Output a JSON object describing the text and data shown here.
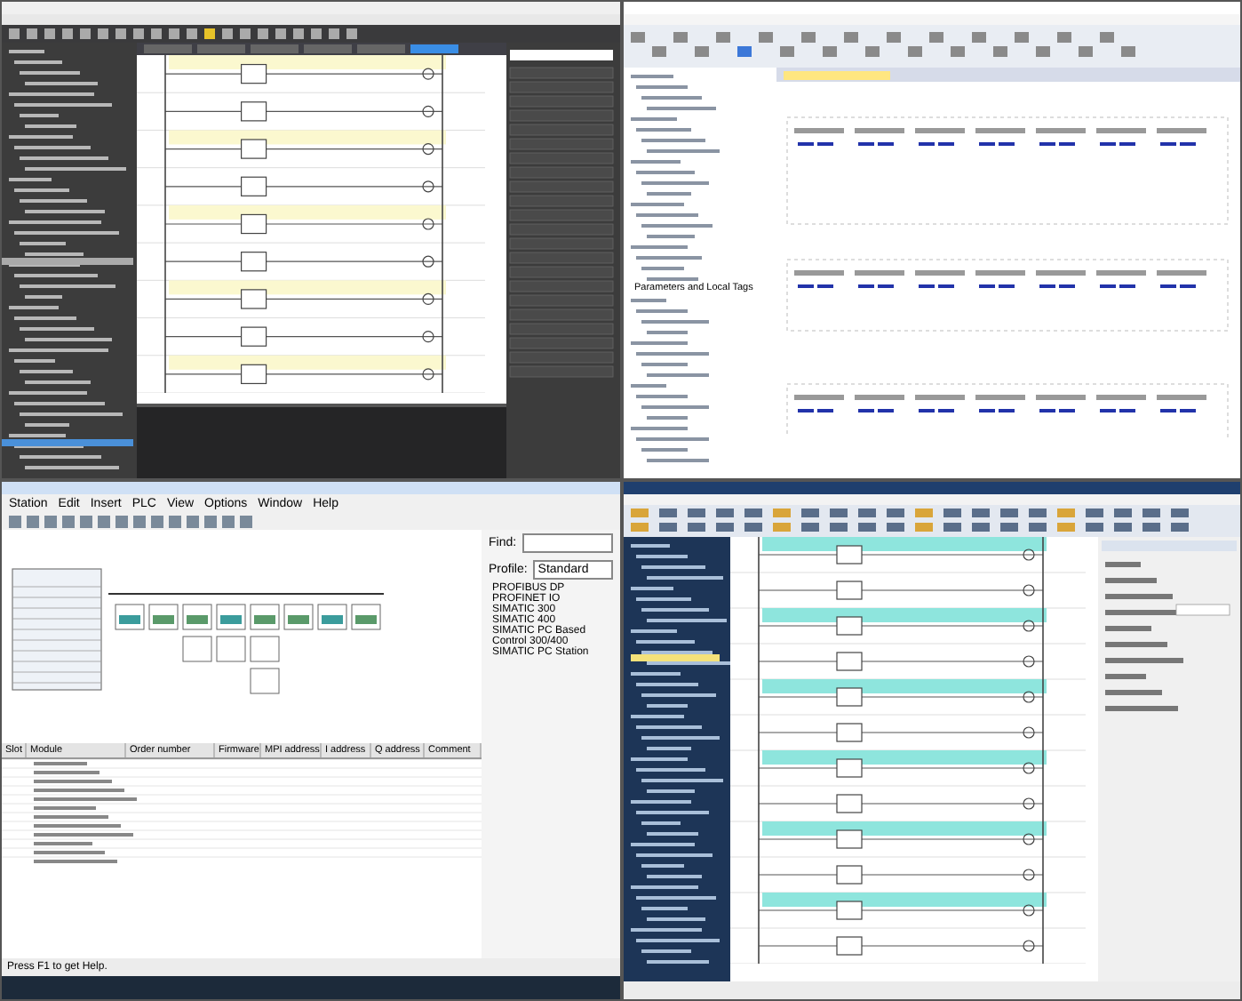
{
  "logix_window": {
    "tree": [
      {
        "label": "Parameters and Local Tags",
        "selected": false
      }
    ]
  },
  "hw_config_window": {
    "menu": [
      "Station",
      "Edit",
      "Insert",
      "PLC",
      "View",
      "Options",
      "Window",
      "Help"
    ],
    "catalog": {
      "find_label": "Find:",
      "profile_label": "Profile:",
      "profile_value": "Standard",
      "items": [
        "PROFIBUS DP",
        "PROFINET IO",
        "SIMATIC 300",
        "SIMATIC 400",
        "SIMATIC PC Based Control 300/400",
        "SIMATIC PC Station"
      ]
    },
    "table": {
      "columns": [
        "Slot",
        "Module",
        "Order number",
        "Firmware",
        "MPI address",
        "I address",
        "Q address",
        "Comment"
      ]
    },
    "status_bar": "Press F1 to get Help."
  }
}
